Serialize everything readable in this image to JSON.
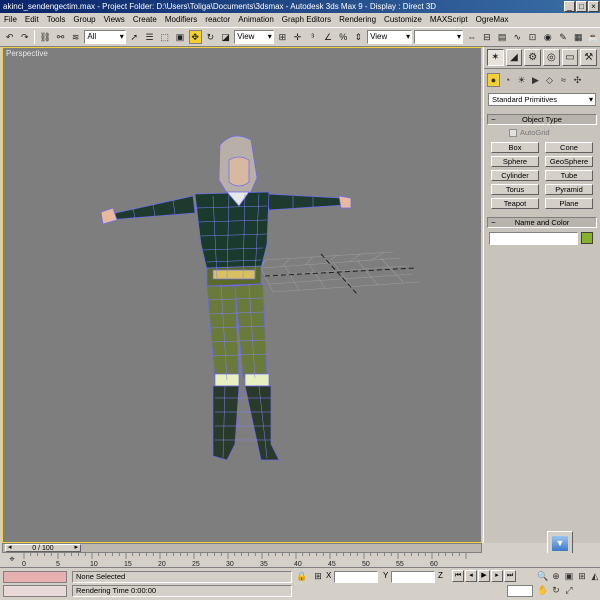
{
  "window": {
    "title": "akinci_sendengectim.max - Project Folder: D:\\Users\\Toliga\\Documents\\3dsmax - Autodesk 3ds Max 9 - Display : Direct 3D",
    "minimize": "_",
    "maximize": "□",
    "close": "×"
  },
  "menu": {
    "items": [
      "File",
      "Edit",
      "Tools",
      "Group",
      "Views",
      "Create",
      "Modifiers",
      "reactor",
      "Animation",
      "Graph Editors",
      "Rendering",
      "Customize",
      "MAXScript",
      "OgreMax"
    ]
  },
  "toolbar": {
    "selection_filter": "All",
    "reference_coord": "View",
    "view_dropdown2": "View"
  },
  "viewport": {
    "label": "Perspective",
    "background": "#7e7e7e",
    "active_border": "#f0d040"
  },
  "command_panel": {
    "category": "Standard Primitives",
    "object_type_title": "Object Type",
    "autogrid_label": "AutoGrid",
    "primitives": [
      "Box",
      "Cone",
      "Sphere",
      "GeoSphere",
      "Cylinder",
      "Tube",
      "Torus",
      "Pyramid",
      "Teapot",
      "Plane"
    ],
    "name_color_title": "Name and Color",
    "object_name": "",
    "object_color": "#86b230"
  },
  "timeline": {
    "frame_display": "0 / 100",
    "ticks": [
      "0",
      "5",
      "10",
      "15",
      "20",
      "25",
      "30",
      "35",
      "40",
      "45",
      "50",
      "55",
      "60"
    ]
  },
  "status": {
    "selection": "None Selected",
    "rendering_time": "Rendering Time  0:00:00",
    "x_label": "X",
    "y_label": "Y",
    "z_label": "Z"
  }
}
